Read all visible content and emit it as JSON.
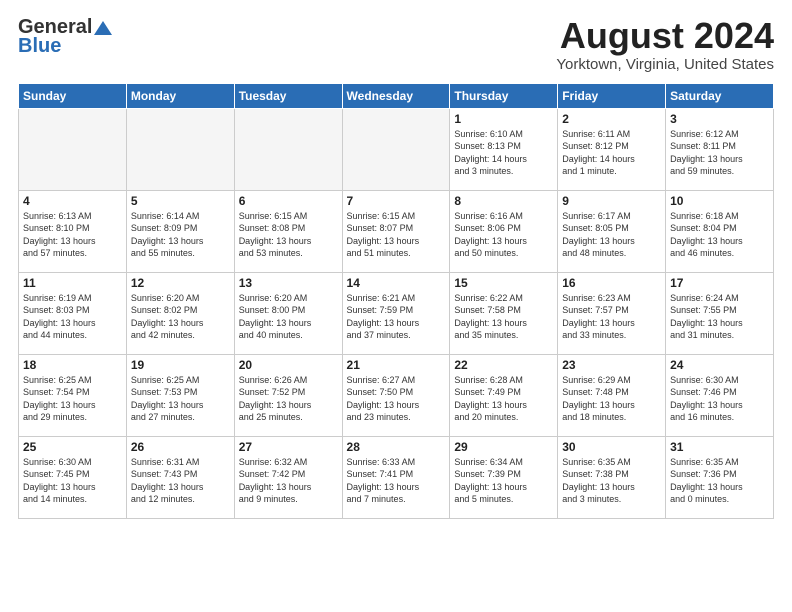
{
  "header": {
    "logo_general": "General",
    "logo_blue": "Blue",
    "month_title": "August 2024",
    "location": "Yorktown, Virginia, United States"
  },
  "weekdays": [
    "Sunday",
    "Monday",
    "Tuesday",
    "Wednesday",
    "Thursday",
    "Friday",
    "Saturday"
  ],
  "weeks": [
    [
      {
        "day": "",
        "info": ""
      },
      {
        "day": "",
        "info": ""
      },
      {
        "day": "",
        "info": ""
      },
      {
        "day": "",
        "info": ""
      },
      {
        "day": "1",
        "info": "Sunrise: 6:10 AM\nSunset: 8:13 PM\nDaylight: 14 hours\nand 3 minutes."
      },
      {
        "day": "2",
        "info": "Sunrise: 6:11 AM\nSunset: 8:12 PM\nDaylight: 14 hours\nand 1 minute."
      },
      {
        "day": "3",
        "info": "Sunrise: 6:12 AM\nSunset: 8:11 PM\nDaylight: 13 hours\nand 59 minutes."
      }
    ],
    [
      {
        "day": "4",
        "info": "Sunrise: 6:13 AM\nSunset: 8:10 PM\nDaylight: 13 hours\nand 57 minutes."
      },
      {
        "day": "5",
        "info": "Sunrise: 6:14 AM\nSunset: 8:09 PM\nDaylight: 13 hours\nand 55 minutes."
      },
      {
        "day": "6",
        "info": "Sunrise: 6:15 AM\nSunset: 8:08 PM\nDaylight: 13 hours\nand 53 minutes."
      },
      {
        "day": "7",
        "info": "Sunrise: 6:15 AM\nSunset: 8:07 PM\nDaylight: 13 hours\nand 51 minutes."
      },
      {
        "day": "8",
        "info": "Sunrise: 6:16 AM\nSunset: 8:06 PM\nDaylight: 13 hours\nand 50 minutes."
      },
      {
        "day": "9",
        "info": "Sunrise: 6:17 AM\nSunset: 8:05 PM\nDaylight: 13 hours\nand 48 minutes."
      },
      {
        "day": "10",
        "info": "Sunrise: 6:18 AM\nSunset: 8:04 PM\nDaylight: 13 hours\nand 46 minutes."
      }
    ],
    [
      {
        "day": "11",
        "info": "Sunrise: 6:19 AM\nSunset: 8:03 PM\nDaylight: 13 hours\nand 44 minutes."
      },
      {
        "day": "12",
        "info": "Sunrise: 6:20 AM\nSunset: 8:02 PM\nDaylight: 13 hours\nand 42 minutes."
      },
      {
        "day": "13",
        "info": "Sunrise: 6:20 AM\nSunset: 8:00 PM\nDaylight: 13 hours\nand 40 minutes."
      },
      {
        "day": "14",
        "info": "Sunrise: 6:21 AM\nSunset: 7:59 PM\nDaylight: 13 hours\nand 37 minutes."
      },
      {
        "day": "15",
        "info": "Sunrise: 6:22 AM\nSunset: 7:58 PM\nDaylight: 13 hours\nand 35 minutes."
      },
      {
        "day": "16",
        "info": "Sunrise: 6:23 AM\nSunset: 7:57 PM\nDaylight: 13 hours\nand 33 minutes."
      },
      {
        "day": "17",
        "info": "Sunrise: 6:24 AM\nSunset: 7:55 PM\nDaylight: 13 hours\nand 31 minutes."
      }
    ],
    [
      {
        "day": "18",
        "info": "Sunrise: 6:25 AM\nSunset: 7:54 PM\nDaylight: 13 hours\nand 29 minutes."
      },
      {
        "day": "19",
        "info": "Sunrise: 6:25 AM\nSunset: 7:53 PM\nDaylight: 13 hours\nand 27 minutes."
      },
      {
        "day": "20",
        "info": "Sunrise: 6:26 AM\nSunset: 7:52 PM\nDaylight: 13 hours\nand 25 minutes."
      },
      {
        "day": "21",
        "info": "Sunrise: 6:27 AM\nSunset: 7:50 PM\nDaylight: 13 hours\nand 23 minutes."
      },
      {
        "day": "22",
        "info": "Sunrise: 6:28 AM\nSunset: 7:49 PM\nDaylight: 13 hours\nand 20 minutes."
      },
      {
        "day": "23",
        "info": "Sunrise: 6:29 AM\nSunset: 7:48 PM\nDaylight: 13 hours\nand 18 minutes."
      },
      {
        "day": "24",
        "info": "Sunrise: 6:30 AM\nSunset: 7:46 PM\nDaylight: 13 hours\nand 16 minutes."
      }
    ],
    [
      {
        "day": "25",
        "info": "Sunrise: 6:30 AM\nSunset: 7:45 PM\nDaylight: 13 hours\nand 14 minutes."
      },
      {
        "day": "26",
        "info": "Sunrise: 6:31 AM\nSunset: 7:43 PM\nDaylight: 13 hours\nand 12 minutes."
      },
      {
        "day": "27",
        "info": "Sunrise: 6:32 AM\nSunset: 7:42 PM\nDaylight: 13 hours\nand 9 minutes."
      },
      {
        "day": "28",
        "info": "Sunrise: 6:33 AM\nSunset: 7:41 PM\nDaylight: 13 hours\nand 7 minutes."
      },
      {
        "day": "29",
        "info": "Sunrise: 6:34 AM\nSunset: 7:39 PM\nDaylight: 13 hours\nand 5 minutes."
      },
      {
        "day": "30",
        "info": "Sunrise: 6:35 AM\nSunset: 7:38 PM\nDaylight: 13 hours\nand 3 minutes."
      },
      {
        "day": "31",
        "info": "Sunrise: 6:35 AM\nSunset: 7:36 PM\nDaylight: 13 hours\nand 0 minutes."
      }
    ]
  ]
}
